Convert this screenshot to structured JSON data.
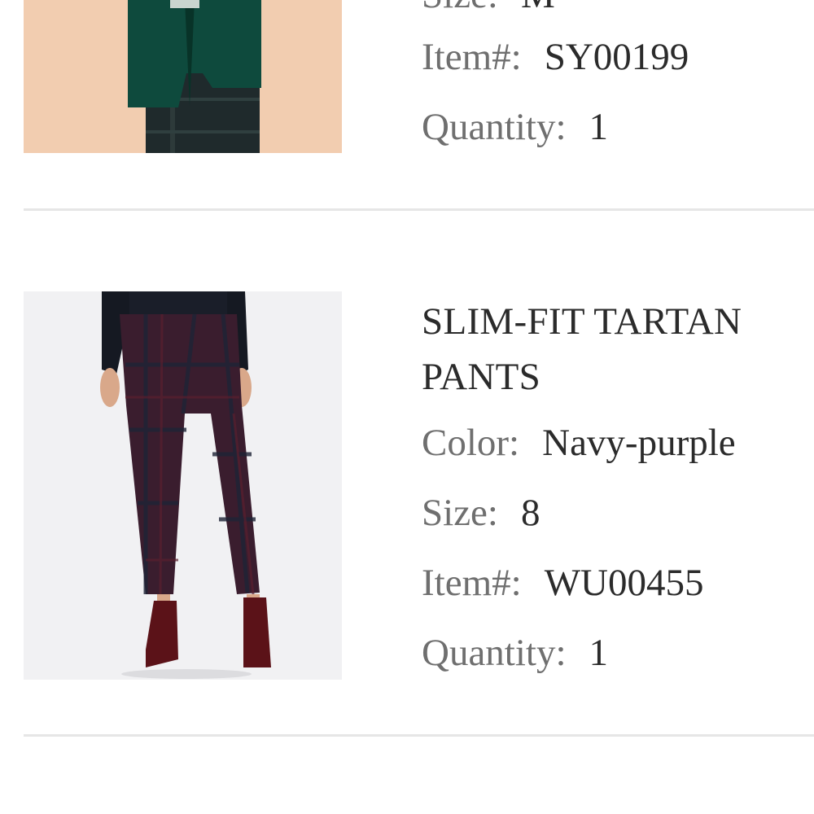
{
  "items": [
    {
      "size_label": "Size:",
      "size_value": "M",
      "item_label": "Item#:",
      "item_value": "SY00199",
      "quantity_label": "Quantity:",
      "quantity_value": "1",
      "image": "green-blazer-tartan-outfit-photo"
    },
    {
      "title_line1": "SLIM-FIT TARTAN",
      "title_line2": "PANTS",
      "color_label": "Color:",
      "color_value": "Navy-purple",
      "size_label": "Size:",
      "size_value": "8",
      "item_label": "Item#:",
      "item_value": "WU00455",
      "quantity_label": "Quantity:",
      "quantity_value": "1",
      "image": "tartan-pants-photo"
    }
  ],
  "colors": {
    "divider": "#e6e6e6",
    "label": "#6f6f6f",
    "value": "#2b2b2b"
  }
}
